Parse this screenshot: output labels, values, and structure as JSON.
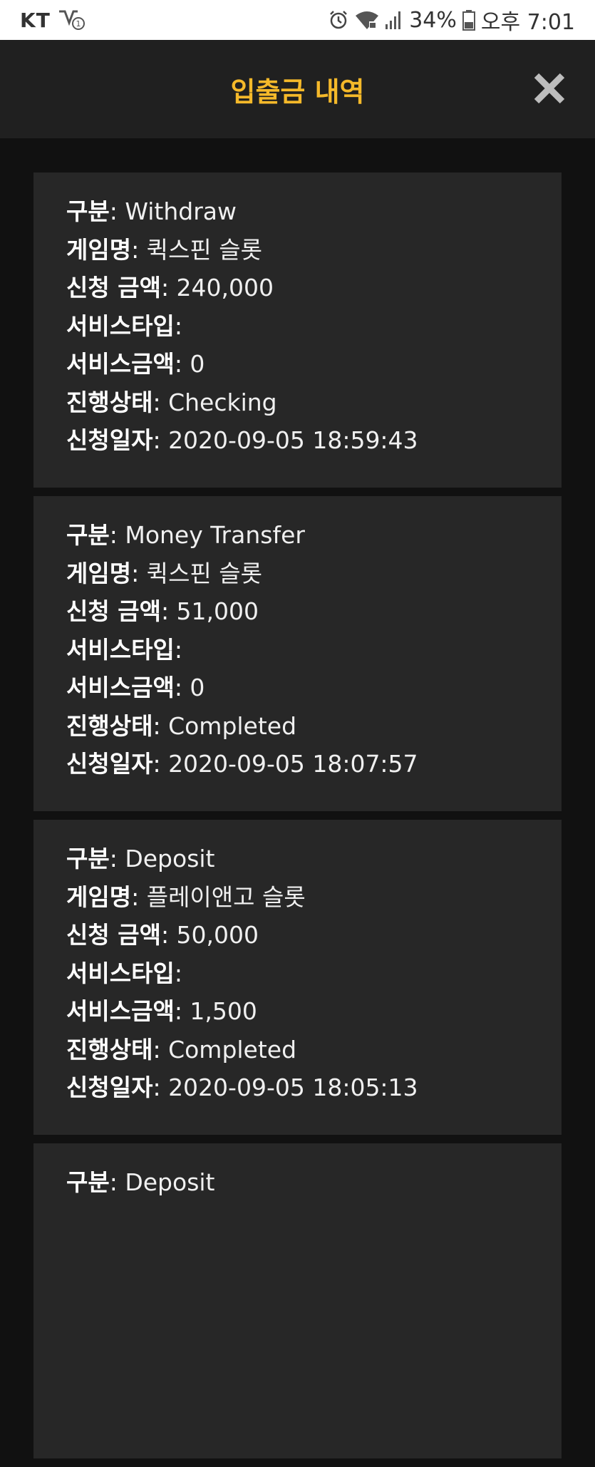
{
  "status_bar": {
    "carrier": "KT",
    "battery": "34%",
    "time": "오후 7:01",
    "icons": [
      "network-badge-icon",
      "alarm-icon",
      "wifi-lock-icon",
      "signal-icon",
      "battery-icon"
    ]
  },
  "header": {
    "title": "입출금 내역",
    "close_icon": "close-icon"
  },
  "labels": {
    "type": "구분",
    "game": "게임명",
    "amount": "신청 금액",
    "service_type": "서비스타입",
    "service_amount": "서비스금액",
    "status": "진행상태",
    "date": "신청일자"
  },
  "transactions": [
    {
      "type": "Withdraw",
      "game": "퀵스핀 슬롯",
      "amount": "240,000",
      "service_type": "",
      "service_amount": "0",
      "status": "Checking",
      "date": "2020-09-05 18:59:43"
    },
    {
      "type": "Money Transfer",
      "game": "퀵스핀 슬롯",
      "amount": "51,000",
      "service_type": "",
      "service_amount": "0",
      "status": "Completed",
      "date": "2020-09-05 18:07:57"
    },
    {
      "type": "Deposit",
      "game": "플레이앤고 슬롯",
      "amount": "50,000",
      "service_type": "",
      "service_amount": "1,500",
      "status": "Completed",
      "date": "2020-09-05 18:05:13"
    },
    {
      "type": "Deposit"
    }
  ],
  "colors": {
    "accent": "#f5b92a",
    "background": "#111111",
    "header_bg": "#202020",
    "card_bg": "#272727",
    "close_icon": "#bdbdbd"
  }
}
